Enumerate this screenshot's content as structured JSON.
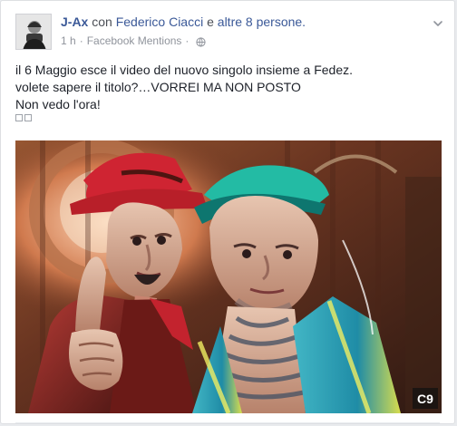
{
  "post": {
    "author": "J-Ax",
    "with_word": "con",
    "tagged": "Federico Ciacci",
    "and_word": "e",
    "others": "altre 8 persone.",
    "time": "1 h",
    "source": "Facebook Mentions",
    "separator_1": "·",
    "separator_2": "·",
    "privacy_icon": "globe-icon",
    "menu_icon": "chevron-down-icon",
    "text": {
      "line1": "il 6 Maggio esce il video del nuovo singolo insieme a Fedez.",
      "line2": "volete sapere il titolo?…VORREI MA NON POSTO",
      "line3": "Non vedo l'ora!"
    },
    "emoji_placeholders": 2,
    "image": {
      "description_icon": "photo",
      "watermark": "C9"
    },
    "colors": {
      "link": "#3b5998",
      "text": "#1d2129",
      "meta": "#90949c",
      "background": "#ffffff",
      "page": "#e9ebee"
    }
  }
}
